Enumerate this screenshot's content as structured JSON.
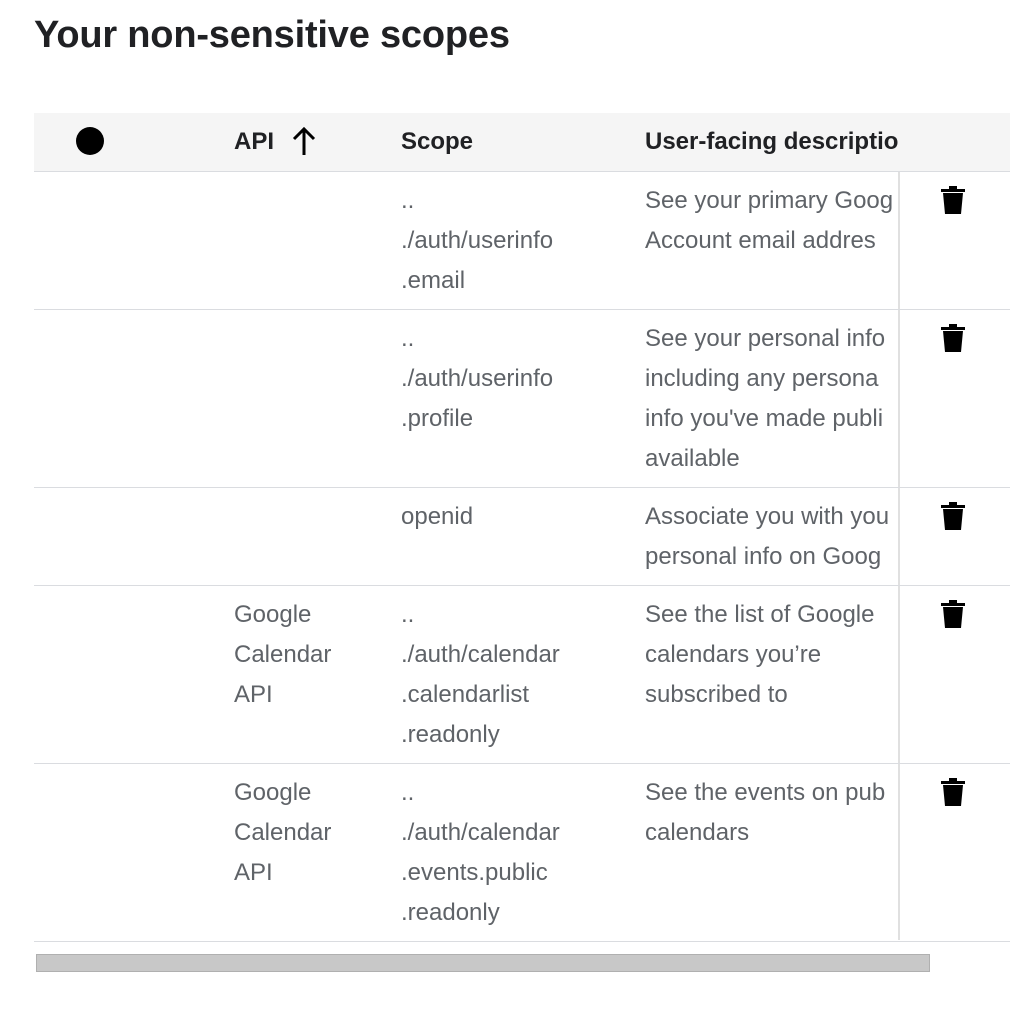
{
  "page": {
    "title": "Your non-sensitive scopes"
  },
  "table": {
    "headers": {
      "api": "API",
      "scope": "Scope",
      "description": "User-facing description"
    },
    "rows": [
      {
        "api": [],
        "scope": [
          "..",
          "./auth/userinfo",
          ".email"
        ],
        "description": [
          "See your primary Goog",
          "Account email addres"
        ]
      },
      {
        "api": [],
        "scope": [
          "..",
          "./auth/userinfo",
          ".profile"
        ],
        "description": [
          "See your personal info",
          "including any persona",
          "info you've made publi",
          "available"
        ]
      },
      {
        "api": [],
        "scope": [
          "openid"
        ],
        "description": [
          "Associate you with you",
          "personal info on Goog"
        ]
      },
      {
        "api": [
          "Google",
          "Calendar",
          "API"
        ],
        "scope": [
          "..",
          "./auth/calendar",
          ".calendarlist",
          ".readonly"
        ],
        "description": [
          "See the list of Google",
          "calendars you’re",
          "subscribed to"
        ]
      },
      {
        "api": [
          "Google",
          "Calendar",
          "API"
        ],
        "scope": [
          "..",
          "./auth/calendar",
          ".events.public",
          ".readonly"
        ],
        "description": [
          "See the events on pub",
          "calendars"
        ]
      }
    ]
  },
  "icons": {
    "select": "filled-circle-icon",
    "sort": "arrow-up-icon",
    "delete": "trash-icon"
  }
}
